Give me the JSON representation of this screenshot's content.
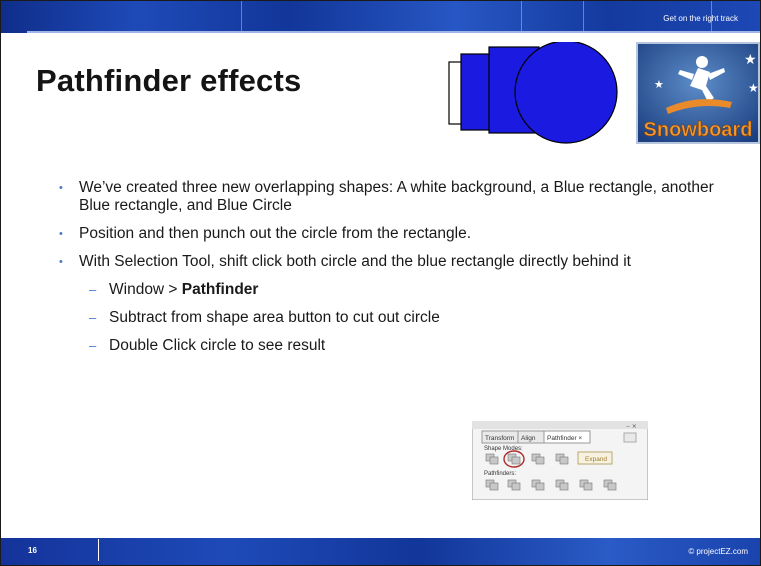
{
  "header": {
    "tagline": "Get on the right track"
  },
  "title": "Pathfinder effects",
  "logo": {
    "icon": "snowboarder-icon",
    "text": "Snowboard"
  },
  "colors": {
    "accent": "#1e4ab8",
    "shape_blue": "#1a1ae0",
    "bullet": "#4d79c7"
  },
  "bullets": [
    {
      "text": "We’ve created three new overlapping shapes:  A white background, a Blue rectangle, another Blue rectangle, and Blue Circle"
    },
    {
      "text": "Position and then punch out the circle from the rectangle."
    },
    {
      "text": "With Selection Tool, shift click both circle and the blue rectangle directly behind it"
    }
  ],
  "sub_bullets": [
    {
      "prefix": "Window > ",
      "bold": "Pathfinder"
    },
    {
      "text": "Subtract from shape area button to cut out circle"
    },
    {
      "text": "Double Click circle to see result"
    }
  ],
  "pathfinder_panel": {
    "tabs": [
      "Transform",
      "Align",
      "Pathfinder ×"
    ],
    "shape_modes_label": "Shape Modes:",
    "expand_label": "Expand",
    "pathfinders_label": "Pathfinders:"
  },
  "footer": {
    "page_number": "16",
    "copyright": "© projectEZ.com"
  }
}
